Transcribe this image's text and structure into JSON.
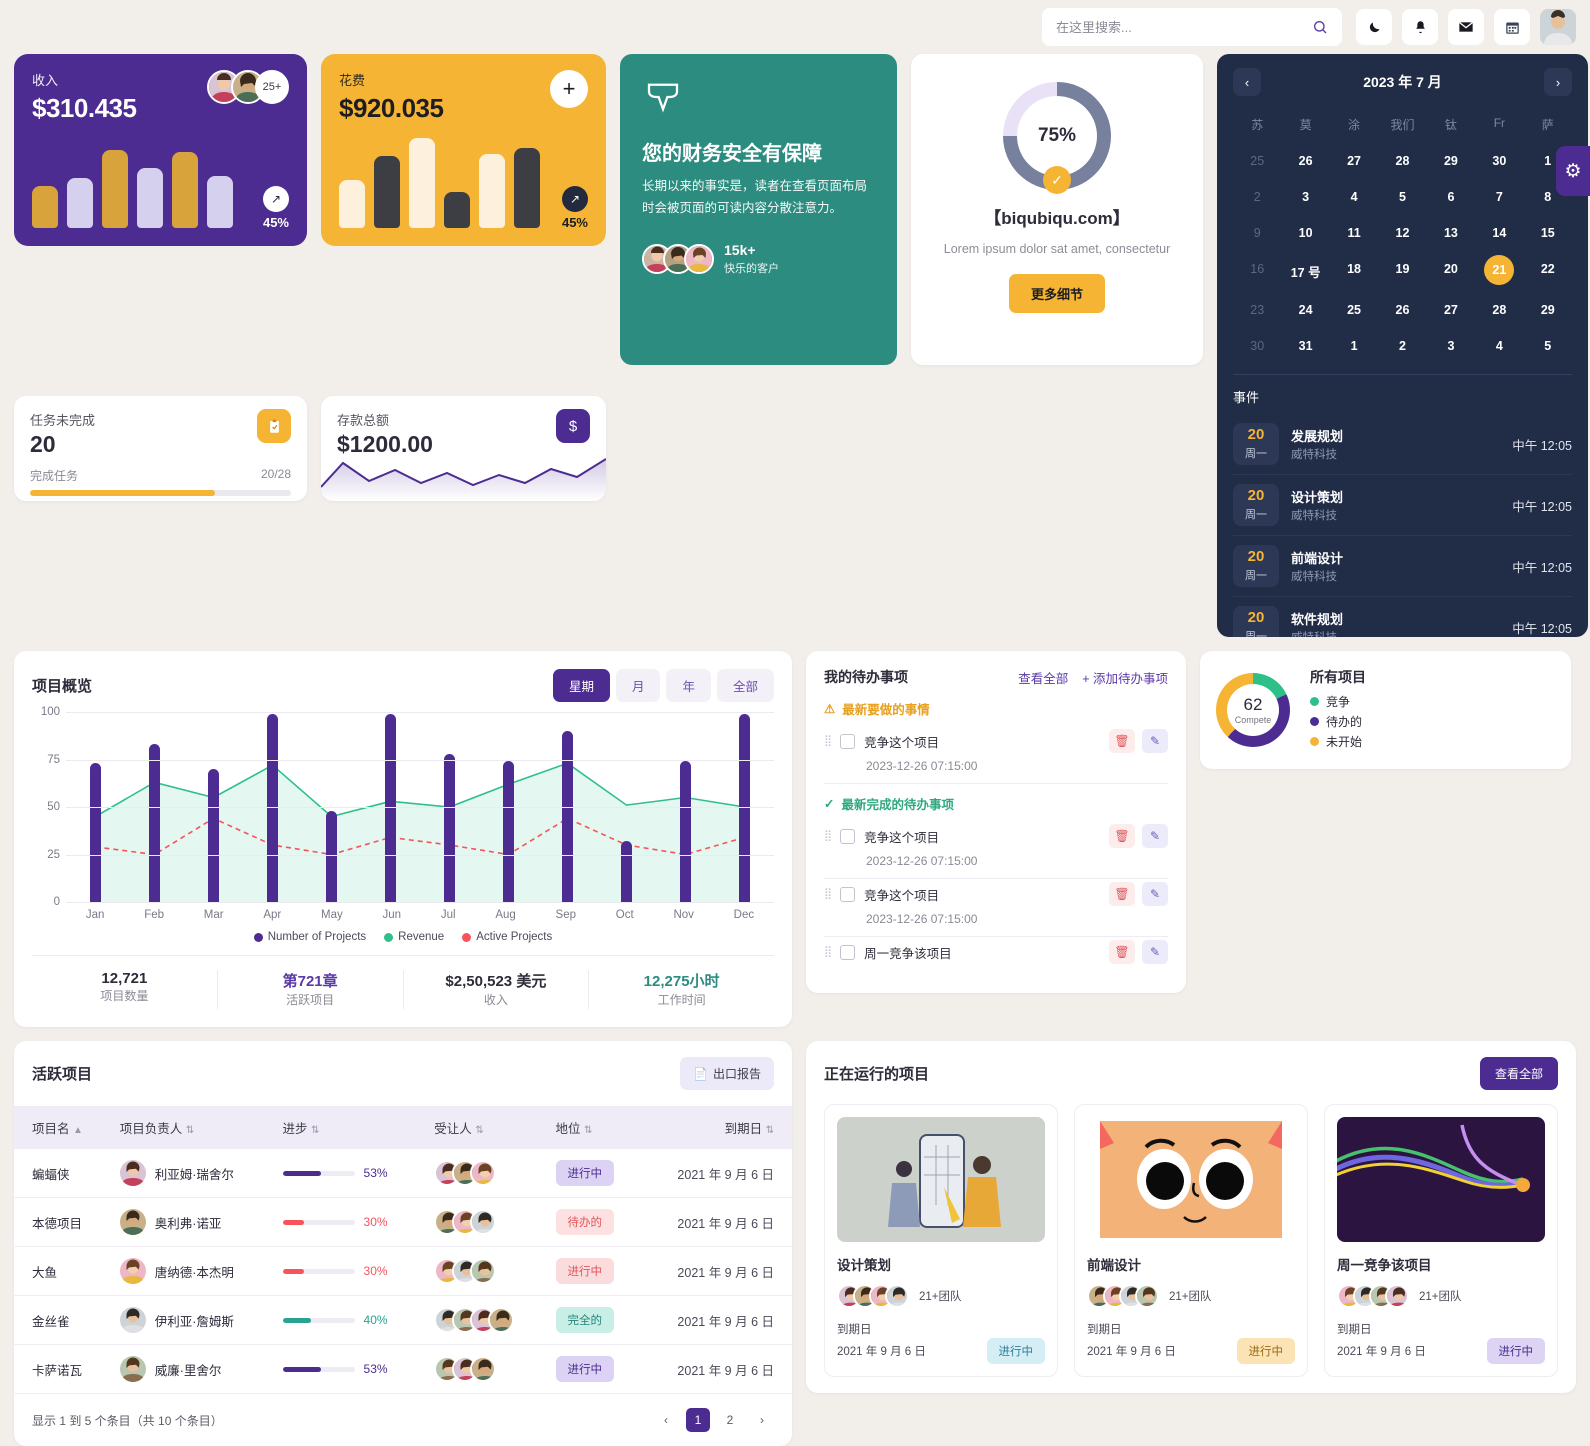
{
  "header": {
    "search_placeholder": "在这里搜索...",
    "icons": [
      {
        "name": "moon-icon",
        "glyph": "🌙"
      },
      {
        "name": "bell-icon",
        "glyph": "🔔"
      },
      {
        "name": "mail-icon",
        "glyph": "✉"
      },
      {
        "name": "calendar-icon",
        "glyph": "📅"
      }
    ]
  },
  "gear_tab": {
    "icon": "⚙"
  },
  "cards": {
    "income": {
      "label": "收入",
      "value": "$310.435",
      "more": "25+",
      "pct": "45%",
      "arrow": "↗"
    },
    "expense": {
      "label": "花费",
      "value": "$920.035",
      "plus": "+",
      "pct": "45%",
      "arrow": "↗"
    },
    "tasks": {
      "label": "任务未完成",
      "value": "20",
      "sub_left": "完成任务",
      "sub_right": "20/28",
      "progress": 71,
      "icon": "📋"
    },
    "deposit": {
      "label": "存款总额",
      "value": "$1200.00",
      "icon": "$"
    }
  },
  "promo": {
    "title": "您的财务安全有保障",
    "body": "长期以来的事实是，读者在查看页面布局时会被页面的可读内容分散注意力。",
    "count": "15k+",
    "count_label": "快乐的客户"
  },
  "gauge": {
    "percent": "75%",
    "check": "✓",
    "title": "【biqubiqu.com】",
    "subtitle": "Lorem ipsum dolor sat amet, consectetur",
    "button": "更多细节"
  },
  "calendar": {
    "title": "2023 年 7 月",
    "prev": "‹",
    "next": "›",
    "dow": [
      "苏",
      "莫",
      "涂",
      "我们",
      "钛",
      "Fr",
      "萨"
    ],
    "days": [
      {
        "n": "25",
        "muted": true
      },
      {
        "n": "26"
      },
      {
        "n": "27"
      },
      {
        "n": "28"
      },
      {
        "n": "29"
      },
      {
        "n": "30"
      },
      {
        "n": "1"
      },
      {
        "n": "2",
        "muted": true
      },
      {
        "n": "3"
      },
      {
        "n": "4"
      },
      {
        "n": "5"
      },
      {
        "n": "6"
      },
      {
        "n": "7"
      },
      {
        "n": "8"
      },
      {
        "n": "9",
        "muted": true
      },
      {
        "n": "10"
      },
      {
        "n": "11"
      },
      {
        "n": "12"
      },
      {
        "n": "13"
      },
      {
        "n": "14"
      },
      {
        "n": "15"
      },
      {
        "n": "16",
        "muted": true
      },
      {
        "n": "17 号"
      },
      {
        "n": "18"
      },
      {
        "n": "19"
      },
      {
        "n": "20"
      },
      {
        "n": "21",
        "selected": true
      },
      {
        "n": "22"
      },
      {
        "n": "23",
        "muted": true
      },
      {
        "n": "24"
      },
      {
        "n": "25"
      },
      {
        "n": "26"
      },
      {
        "n": "27"
      },
      {
        "n": "28"
      },
      {
        "n": "29"
      },
      {
        "n": "30",
        "muted": true
      },
      {
        "n": "31"
      },
      {
        "n": "1"
      },
      {
        "n": "2"
      },
      {
        "n": "3"
      },
      {
        "n": "4"
      },
      {
        "n": "5"
      }
    ],
    "events_title": "事件",
    "events": [
      {
        "day": "20",
        "weekday": "周一",
        "title": "发展规划",
        "org": "威特科技",
        "time": "中午 12:05"
      },
      {
        "day": "20",
        "weekday": "周一",
        "title": "设计策划",
        "org": "威特科技",
        "time": "中午 12:05"
      },
      {
        "day": "20",
        "weekday": "周一",
        "title": "前端设计",
        "org": "威特科技",
        "time": "中午 12:05"
      },
      {
        "day": "20",
        "weekday": "周一",
        "title": "软件规划",
        "org": "威特科技",
        "time": "中午 12:05"
      }
    ]
  },
  "chart_data": {
    "type": "bar",
    "title": "项目概览",
    "categories": [
      "Jan",
      "Feb",
      "Mar",
      "Apr",
      "May",
      "Jun",
      "Jul",
      "Aug",
      "Sep",
      "Oct",
      "Nov",
      "Dec"
    ],
    "ylim": [
      0,
      100
    ],
    "yticks": [
      0,
      25,
      50,
      75,
      100
    ],
    "grid": true,
    "legend_position": "bottom",
    "series": [
      {
        "name": "Number of Projects",
        "type": "bar",
        "color": "#4c2c91",
        "values": [
          73,
          83,
          70,
          99,
          48,
          99,
          78,
          74,
          90,
          32,
          74,
          99
        ]
      },
      {
        "name": "Revenue",
        "type": "area",
        "color": "#2fc08a",
        "values": [
          45,
          63,
          55,
          72,
          45,
          53,
          50,
          62,
          73,
          51,
          55,
          50
        ]
      },
      {
        "name": "Active Projects",
        "type": "line",
        "color": "#f7535b",
        "values": [
          29,
          25,
          44,
          30,
          25,
          34,
          30,
          25,
          44,
          30,
          25,
          34
        ]
      }
    ],
    "ranges": [
      "星期",
      "月",
      "年",
      "全部"
    ],
    "active_range": "星期",
    "kpis": [
      {
        "value": "12,721",
        "label": "项目数量",
        "color": "#2c2c3a"
      },
      {
        "value": "第721章",
        "label": "活跃项目",
        "color": "#5b39a8"
      },
      {
        "value": "$2,50,523 美元",
        "label": "收入",
        "color": "#2c2c3a"
      },
      {
        "value": "12,275小时",
        "label": "工作时间",
        "color": "#2d8c80"
      }
    ]
  },
  "todo": {
    "title": "我的待办事项",
    "view_all": "查看全部",
    "add": "+ 添加待办事项",
    "section_pending": "最新要做的事情",
    "section_done": "最新完成的待办事项",
    "items": [
      {
        "text": "竞争这个项目",
        "time": "2023-12-26 07:15:00",
        "section": "pending"
      },
      {
        "text": "竞争这个项目",
        "time": "2023-12-26 07:15:00",
        "section": "done"
      },
      {
        "text": "竞争这个项目",
        "time": "2023-12-26 07:15:00",
        "section": ""
      },
      {
        "text": "周一竞争该项目",
        "time": "",
        "section": ""
      }
    ],
    "delete_icon": "🗑",
    "edit_icon": "✎"
  },
  "donut": {
    "center_value": "62",
    "center_label": "Compete",
    "title": "所有项目",
    "legend": [
      {
        "label": "竞争",
        "color": "#2fc08a",
        "share": 18
      },
      {
        "label": "待办的",
        "color": "#4c2c91",
        "share": 44
      },
      {
        "label": "未开始",
        "color": "#f5b433",
        "share": 38
      }
    ]
  },
  "table": {
    "title": "活跃项目",
    "export": "出口报告",
    "export_icon": "📄",
    "columns": [
      "项目名",
      "项目负责人",
      "进步",
      "受让人",
      "地位",
      "到期日"
    ],
    "sort_active": "▲",
    "sort_icon": "⇅",
    "rows": [
      {
        "name": "蝙蝠侠",
        "owner": "利亚姆·瑞舍尔",
        "progress": 53,
        "pct": "53%",
        "bar": "#4c2c91",
        "status": "进行中",
        "status_bg": "#dcd3f4",
        "status_fg": "#4c2c91",
        "due": "2021 年 9 月 6 日",
        "team": 3
      },
      {
        "name": "本德项目",
        "owner": "奥利弗·诺亚",
        "progress": 30,
        "pct": "30%",
        "bar": "#f7535b",
        "status": "待办的",
        "status_bg": "#fde0e1",
        "status_fg": "#e0575b",
        "due": "2021 年 9 月 6 日",
        "team": 3
      },
      {
        "name": "大鱼",
        "owner": "唐纳德·本杰明",
        "progress": 30,
        "pct": "30%",
        "bar": "#f7535b",
        "status": "进行中",
        "status_bg": "#fbdcdd",
        "status_fg": "#e0575b",
        "due": "2021 年 9 月 6 日",
        "team": 3
      },
      {
        "name": "金丝雀",
        "owner": "伊利亚·詹姆斯",
        "progress": 40,
        "pct": "40%",
        "bar": "#29a193",
        "status": "完全的",
        "status_bg": "#c9eee6",
        "status_fg": "#22867a",
        "due": "2021 年 9 月 6 日",
        "team": 4
      },
      {
        "name": "卡萨诺瓦",
        "owner": "威廉·里舍尔",
        "progress": 53,
        "pct": "53%",
        "bar": "#4c2c91",
        "status": "进行中",
        "status_bg": "#dcd3f4",
        "status_fg": "#4c2c91",
        "due": "2021 年 9 月 6 日",
        "team": 3
      }
    ],
    "footer": "显示 1 到 5 个条目（共 10 个条目）",
    "pager": {
      "prev": "‹",
      "pages": [
        "1",
        "2"
      ],
      "active": "1",
      "next": "›"
    }
  },
  "running": {
    "title": "正在运行的项目",
    "view_all": "查看全部",
    "items": [
      {
        "name": "设计策划",
        "team": "21+团队",
        "due_label": "到期日",
        "due": "2021 年 9 月 6 日",
        "status": "进行中",
        "status_bg": "#d5eef6",
        "status_fg": "#2f7f99",
        "thumb": "mobile-design"
      },
      {
        "name": "前端设计",
        "team": "21+团队",
        "due_label": "到期日",
        "due": "2021 年 9 月 6 日",
        "status": "进行中",
        "status_bg": "#fbe3b5",
        "status_fg": "#9a6c10",
        "thumb": "cartoon-face"
      },
      {
        "name": "周一竞争该项目",
        "team": "21+团队",
        "due_label": "到期日",
        "due": "2021 年 9 月 6 日",
        "status": "进行中",
        "status_bg": "#ddd3f2",
        "status_fg": "#4c2c91",
        "thumb": "abstract-lines"
      }
    ]
  }
}
